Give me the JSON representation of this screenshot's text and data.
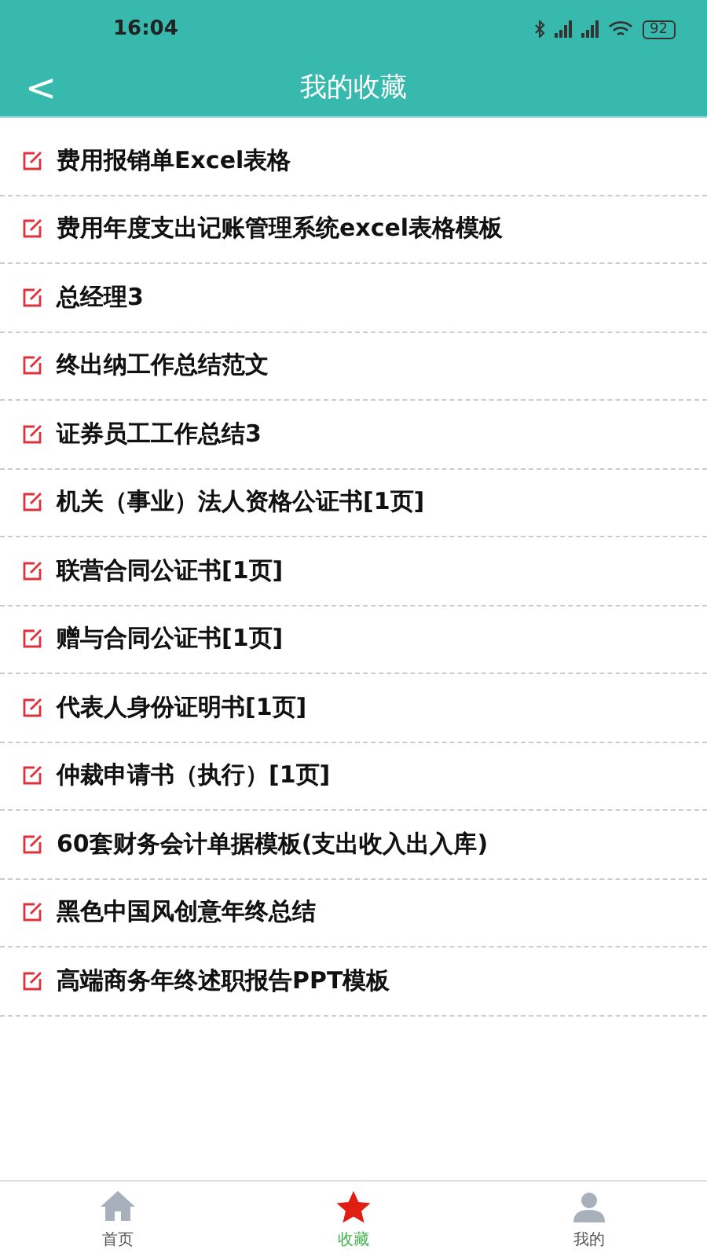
{
  "status_bar": {
    "time": "16:04",
    "battery": "92"
  },
  "header": {
    "back": "<",
    "title": "我的收藏"
  },
  "items": [
    {
      "title": "费用报销单Excel表格"
    },
    {
      "title": "费用年度支出记账管理系统excel表格模板"
    },
    {
      "title": "总经理3"
    },
    {
      "title": "终出纳工作总结范文"
    },
    {
      "title": "证券员工工作总结3"
    },
    {
      "title": "机关（事业）法人资格公证书[1页]"
    },
    {
      "title": "联营合同公证书[1页]"
    },
    {
      "title": "赠与合同公证书[1页]"
    },
    {
      "title": "代表人身份证明书[1页]"
    },
    {
      "title": "仲裁申请书（执行）[1页]"
    },
    {
      "title": "60套财务会计单据模板(支出收入出入库)"
    },
    {
      "title": "黑色中国风创意年终总结"
    },
    {
      "title": "高端商务年终述职报告PPT模板"
    }
  ],
  "tabs": [
    {
      "kind": "home",
      "label": "首页",
      "selected": false
    },
    {
      "kind": "star",
      "label": "收藏",
      "selected": true
    },
    {
      "kind": "person",
      "label": "我的",
      "selected": false
    }
  ]
}
